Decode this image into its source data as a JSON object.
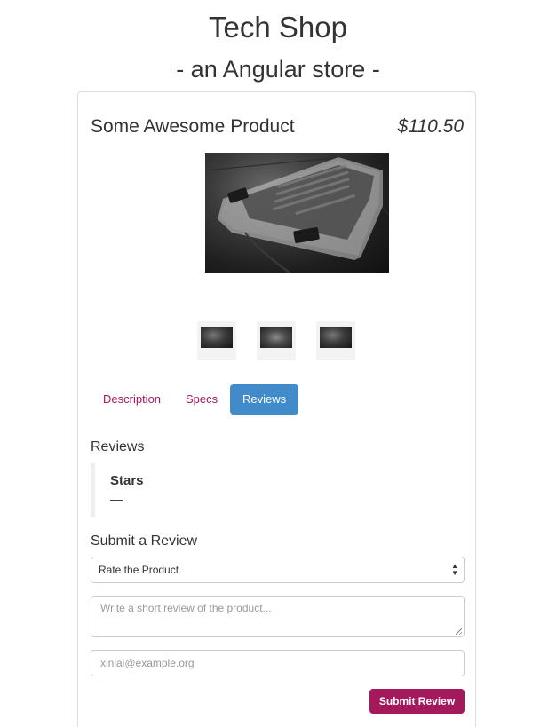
{
  "header": {
    "title": "Tech Shop",
    "subtitle": "- an Angular store -"
  },
  "product": {
    "name": "Some Awesome Product",
    "price": "$110.50",
    "main_image": "keyboard-product-image",
    "thumbnails": [
      "keyboard-thumb-1",
      "keyboard-thumb-2",
      "keyboard-thumb-3"
    ]
  },
  "tabs": [
    {
      "label": "Description",
      "active": false
    },
    {
      "label": "Specs",
      "active": false
    },
    {
      "label": "Reviews",
      "active": true
    }
  ],
  "reviews": {
    "heading": "Reviews",
    "items": [
      {
        "stars": "Stars",
        "body": "—"
      }
    ]
  },
  "review_form": {
    "heading": "Submit a Review",
    "rating_select": "Rate the Product",
    "review_placeholder": "Write a short review of the product...",
    "email_placeholder": "xinlai@example.org",
    "submit_label": "Submit Review"
  },
  "colors": {
    "link": "#a3195b",
    "active_tab": "#428bca",
    "submit_button": "#a3195b"
  }
}
